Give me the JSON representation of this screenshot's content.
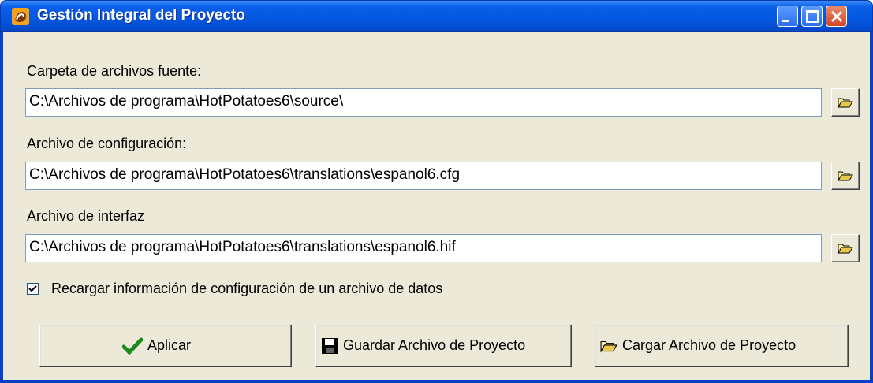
{
  "window": {
    "title": "Gestión Integral del Proyecto",
    "icons": {
      "app": "hotpotatoes-app-icon",
      "minimize": "minimize-icon",
      "maximize": "maximize-icon",
      "close": "close-icon"
    }
  },
  "fields": {
    "source": {
      "label": "Carpeta de archivos fuente:",
      "value": "C:\\Archivos de programa\\HotPotatoes6\\source\\"
    },
    "config": {
      "label": "Archivo de configuración:",
      "value": "C:\\Archivos de programa\\HotPotatoes6\\translations\\espanol6.cfg"
    },
    "interface": {
      "label": "Archivo de interfaz",
      "value": "C:\\Archivos de programa\\HotPotatoes6\\translations\\espanol6.hif"
    }
  },
  "reload_checkbox": {
    "label": "Recargar información de configuración de un archivo de datos",
    "checked": true
  },
  "buttons": {
    "apply": {
      "accel": "A",
      "rest": "plicar",
      "icon": "checkmark-icon"
    },
    "save": {
      "accel": "G",
      "rest": "uardar Archivo de Proyecto",
      "icon": "floppy-disk-icon"
    },
    "load": {
      "accel": "C",
      "rest": "argar Archivo de Proyecto",
      "icon": "open-folder-icon"
    }
  },
  "colors": {
    "titlebar": "#0558e0",
    "face": "#ece9d8",
    "close": "#d0462a"
  }
}
